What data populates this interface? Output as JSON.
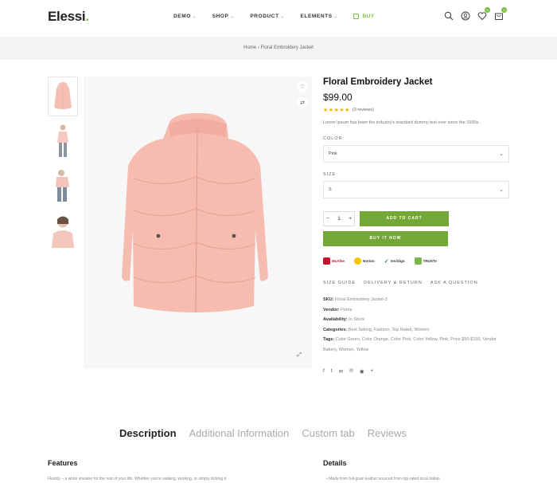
{
  "header": {
    "logo": "Elessi",
    "logo_dot": ".",
    "nav": [
      {
        "label": "DEMO",
        "chev": "⌄"
      },
      {
        "label": "SHOP",
        "chev": "⌄"
      },
      {
        "label": "PRODUCT",
        "chev": "⌄"
      },
      {
        "label": "ELEMENTS",
        "chev": "⌄"
      }
    ],
    "buy_label": "BUY",
    "wishlist_count": "0",
    "cart_count": "0",
    "accent_color": "#7ac142"
  },
  "breadcrumb": {
    "home": "Home",
    "separator": "›",
    "current": "Floral Embroidery Jacket"
  },
  "product": {
    "title": "Floral Embroidery Jacket",
    "price": "$99.00",
    "stars": "★★★★★",
    "rating_value": 5,
    "reviews": "(3 reviews)",
    "description": "Lorem Ipsum has been the industry's standard dummy text ever since the 1500s.",
    "color_label": "COLOR:",
    "color_value": "Pink",
    "size_label": "SIZE:",
    "size_value": "S",
    "quantity": "1",
    "qty_minus": "−",
    "qty_plus": "+",
    "add_to_cart": "ADD TO CART",
    "buy_now": "BUY IT NOW",
    "payment_methods": [
      "McAfee",
      "Norton",
      "VeriSign",
      "TRUSTe"
    ],
    "links": [
      "SIZE GUIDE",
      "DELIVERY & RETURN",
      "ASK A QUESTION"
    ],
    "meta": {
      "sku_label": "SKU:",
      "sku": "Floral Embroidery Jacket-3",
      "vendor_label": "Vendor:",
      "vendor": "Puma",
      "availability_label": "Availability:",
      "availability": "In Stock",
      "categories_label": "Categories:",
      "categories": "Best Selling, Fashion, Top Rated, Women",
      "tags_label": "Tags:",
      "tags": "Color Green, Color Orange, Color Pink, Color Yellow, Pink, Price $50-$150, Vendor Bakery, Women, Yellow"
    },
    "social_icons": [
      "facebook-icon",
      "twitter-icon",
      "email-icon",
      "pinterest-icon",
      "messenger-icon",
      "share-icon"
    ],
    "image_color": "#f7bcb0"
  },
  "tabs": [
    "Description",
    "Additional Information",
    "Custom tab",
    "Reviews"
  ],
  "features": {
    "title": "Features",
    "text": "Fleshly – a white sneaker for the rest of your life. Whether you're walking, working, or simply kicking it"
  },
  "details": {
    "title": "Details",
    "text": "•  Made from full-grain leather sourced from top-rated local Italian"
  }
}
